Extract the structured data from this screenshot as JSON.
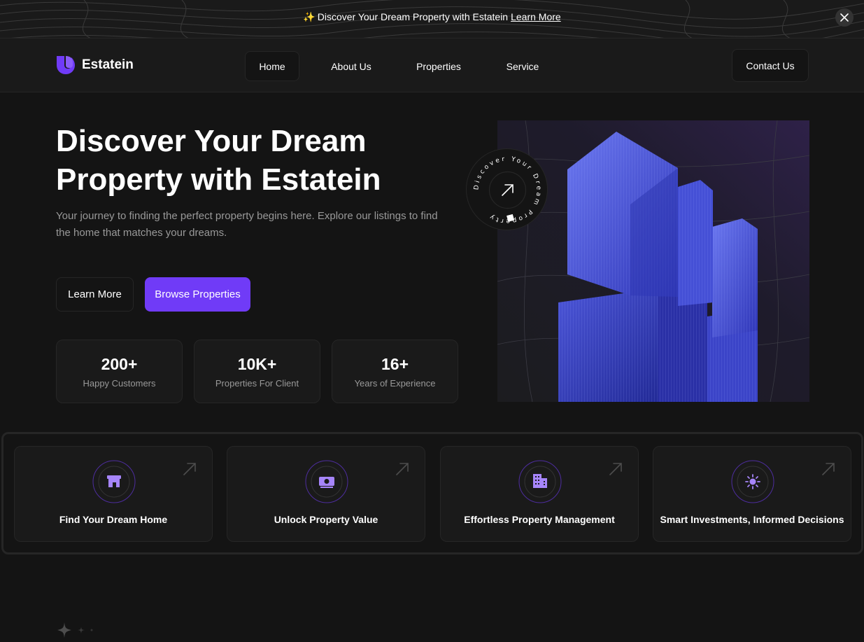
{
  "announcement": {
    "emoji": "✨",
    "text": "Discover Your Dream Property with Estatein",
    "link": "Learn More"
  },
  "brand": {
    "name": "Estatein",
    "accent": "#703bf7"
  },
  "nav": {
    "links": [
      {
        "label": "Home",
        "active": true
      },
      {
        "label": "About Us",
        "active": false
      },
      {
        "label": "Properties",
        "active": false
      },
      {
        "label": "Service",
        "active": false
      }
    ],
    "contact": "Contact Us"
  },
  "hero": {
    "title_line1": "Discover Your Dream",
    "title_line2": "Property with Estatein",
    "subtitle": "Your journey to finding the perfect property begins here. Explore our listings to find the home that matches your dreams.",
    "btn_learn": "Learn More",
    "btn_browse": "Browse Properties",
    "badge_text": "Discover Your Dream Property",
    "stats": [
      {
        "value": "200+",
        "label": "Happy Customers"
      },
      {
        "value": "10K+",
        "label": "Properties For Client"
      },
      {
        "value": "16+",
        "label": "Years of Experience"
      }
    ]
  },
  "features": [
    {
      "label": "Find Your Dream Home",
      "icon": "home-store-icon"
    },
    {
      "label": "Unlock Property Value",
      "icon": "money-icon"
    },
    {
      "label": "Effortless Property Management",
      "icon": "building-icon"
    },
    {
      "label": "Smart Investments, Informed Decisions",
      "icon": "sun-icon"
    }
  ]
}
